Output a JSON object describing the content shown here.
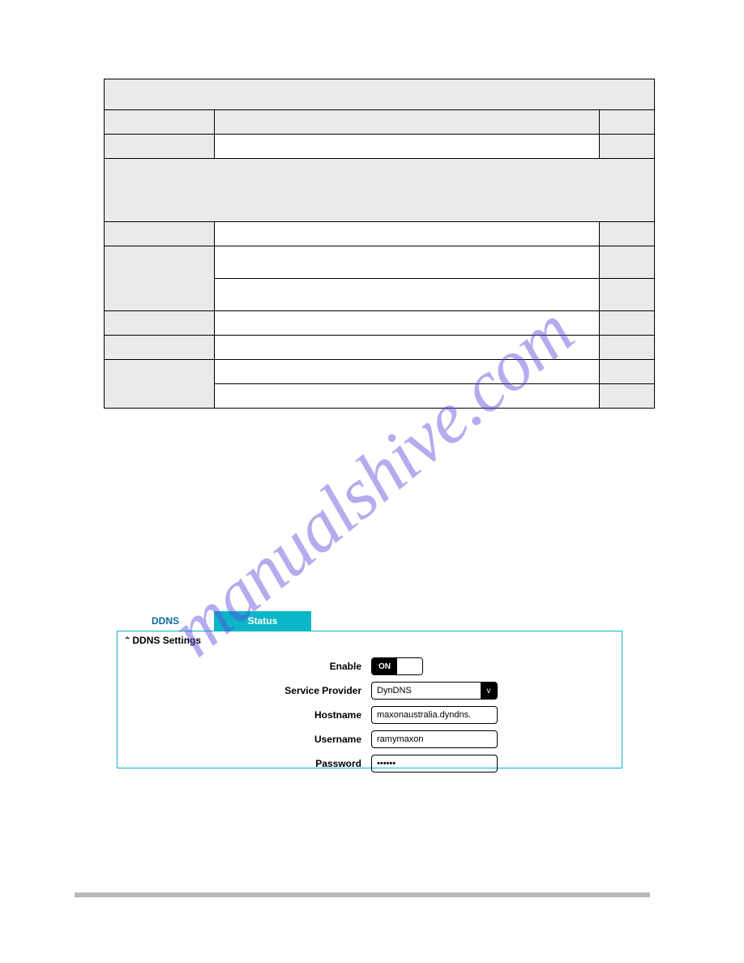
{
  "watermark": "manualshive.com",
  "tabs": {
    "a": "DDNS",
    "b": "Status"
  },
  "panel": {
    "title": "DDNS Settings",
    "rows": {
      "enable": {
        "label": "Enable",
        "state": "ON"
      },
      "provider": {
        "label": "Service Provider",
        "value": "DynDNS"
      },
      "hostname": {
        "label": "Hostname",
        "value": "maxonaustralia.dyndns."
      },
      "username": {
        "label": "Username",
        "value": "ramymaxon"
      },
      "password": {
        "label": "Password",
        "value": "••••••"
      }
    }
  }
}
